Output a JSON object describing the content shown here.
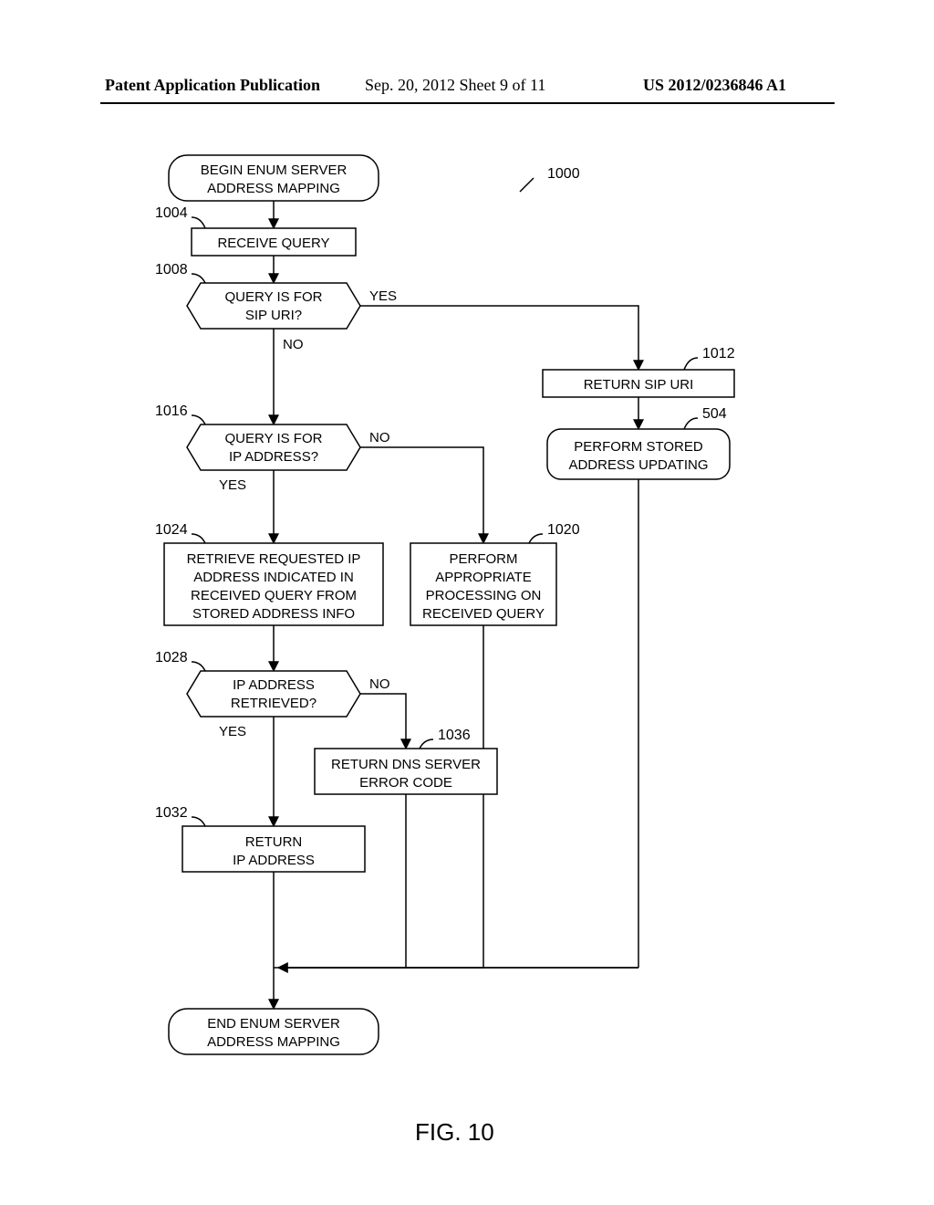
{
  "header": {
    "left": "Patent Application Publication",
    "mid": "Sep. 20, 2012  Sheet 9 of 11",
    "right": "US 2012/0236846 A1"
  },
  "figure_caption": "FIG. 10",
  "refs": {
    "r1000": "1000",
    "r1004": "1004",
    "r1008": "1008",
    "r1012": "1012",
    "r504": "504",
    "r1016": "1016",
    "r1020": "1020",
    "r1024": "1024",
    "r1028": "1028",
    "r1032": "1032",
    "r1036": "1036"
  },
  "boxes": {
    "start_l1": "BEGIN ENUM SERVER",
    "start_l2": "ADDRESS MAPPING",
    "b1004": "RECEIVE QUERY",
    "d1008_l1": "QUERY IS FOR",
    "d1008_l2": "SIP URI?",
    "b1012": "RETURN SIP URI",
    "b504_l1": "PERFORM STORED",
    "b504_l2": "ADDRESS UPDATING",
    "d1016_l1": "QUERY IS FOR",
    "d1016_l2": "IP ADDRESS?",
    "b1020_l1": "PERFORM",
    "b1020_l2": "APPROPRIATE",
    "b1020_l3": "PROCESSING ON",
    "b1020_l4": "RECEIVED QUERY",
    "b1024_l1": "RETRIEVE REQUESTED IP",
    "b1024_l2": "ADDRESS INDICATED IN",
    "b1024_l3": "RECEIVED QUERY FROM",
    "b1024_l4": "STORED ADDRESS INFO",
    "d1028_l1": "IP ADDRESS",
    "d1028_l2": "RETRIEVED?",
    "b1032_l1": "RETURN",
    "b1032_l2": "IP ADDRESS",
    "b1036_l1": "RETURN DNS SERVER",
    "b1036_l2": "ERROR CODE",
    "end_l1": "END ENUM SERVER",
    "end_l2": "ADDRESS MAPPING"
  },
  "labels": {
    "yes": "YES",
    "no": "NO"
  }
}
